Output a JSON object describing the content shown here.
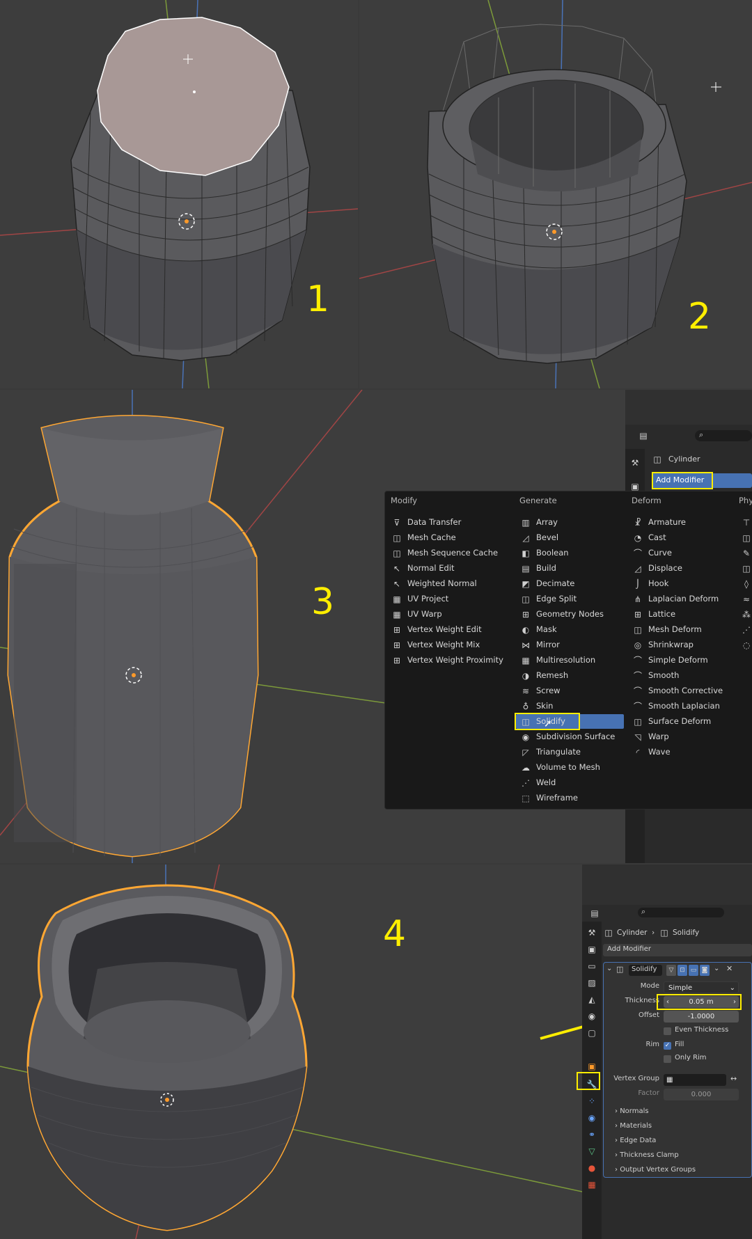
{
  "steps": [
    "1",
    "2",
    "3",
    "4"
  ],
  "menu": {
    "columns": {
      "modify": "Modify",
      "generate": "Generate",
      "deform": "Deform",
      "physics": "Phy"
    },
    "modify_items": [
      "Data Transfer",
      "Mesh Cache",
      "Mesh Sequence Cache",
      "Normal Edit",
      "Weighted Normal",
      "UV Project",
      "UV Warp",
      "Vertex Weight Edit",
      "Vertex Weight Mix",
      "Vertex Weight Proximity"
    ],
    "generate_items": [
      "Array",
      "Bevel",
      "Boolean",
      "Build",
      "Decimate",
      "Edge Split",
      "Geometry Nodes",
      "Mask",
      "Mirror",
      "Multiresolution",
      "Remesh",
      "Screw",
      "Skin",
      "Solidify",
      "Subdivision Surface",
      "Triangulate",
      "Volume to Mesh",
      "Weld",
      "Wireframe"
    ],
    "deform_items": [
      "Armature",
      "Cast",
      "Curve",
      "Displace",
      "Hook",
      "Laplacian Deform",
      "Lattice",
      "Mesh Deform",
      "Shrinkwrap",
      "Simple Deform",
      "Smooth",
      "Smooth Corrective",
      "Smooth Laplacian",
      "Surface Deform",
      "Warp",
      "Wave"
    ],
    "highlighted": "Solidify"
  },
  "props3": {
    "object_name": "Cylinder",
    "add_modifier": "Add Modifier"
  },
  "props4": {
    "breadcrumb_object": "Cylinder",
    "breadcrumb_modifier": "Solidify",
    "add_modifier": "Add Modifier",
    "modifier_name": "Solidify",
    "mode_label": "Mode",
    "mode_value": "Simple",
    "thickness_label": "Thickness",
    "thickness_value": "0.05 m",
    "offset_label": "Offset",
    "offset_value": "-1.0000",
    "even_thickness": "Even Thickness",
    "rim_label": "Rim",
    "fill": "Fill",
    "only_rim": "Only Rim",
    "vertex_group_label": "Vertex Group",
    "factor_label": "Factor",
    "factor_value": "0.000",
    "sections": [
      "Normals",
      "Materials",
      "Edge Data",
      "Thickness Clamp",
      "Output Vertex Groups"
    ]
  },
  "colors": {
    "annotation": "#ffee00",
    "selection": "#ffa733",
    "highlight": "#4772b3"
  }
}
